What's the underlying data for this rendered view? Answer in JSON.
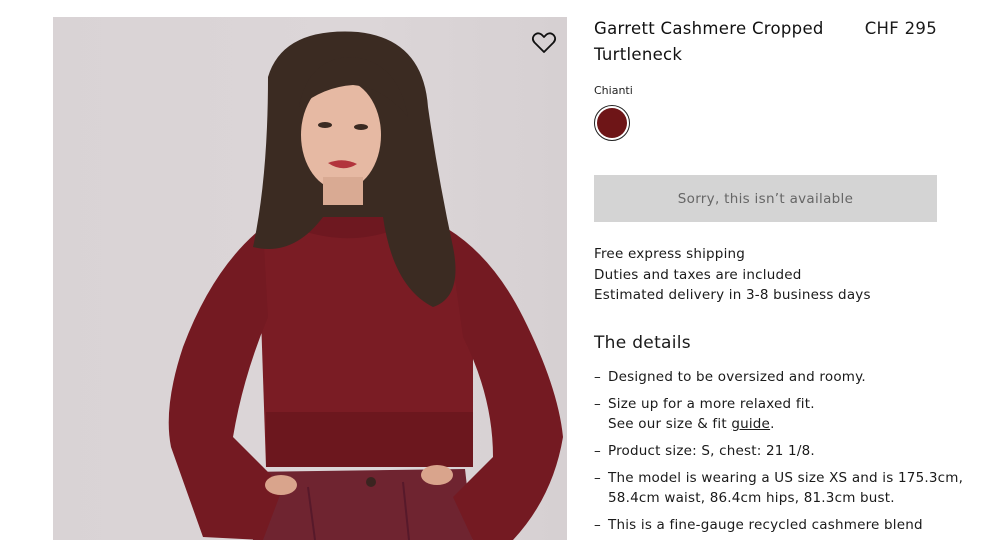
{
  "product": {
    "title": "Garrett Cashmere Cropped Turtleneck",
    "price": "CHF 295",
    "color_name": "Chianti",
    "swatch_color": "#6e1517"
  },
  "actions": {
    "unavailable_label": "Sorry, this isn’t available",
    "wishlist_icon": "heart-outline-icon"
  },
  "shipping": {
    "lines": [
      "Free express shipping",
      "Duties and taxes are included",
      "Estimated delivery in 3-8 business days"
    ]
  },
  "details": {
    "heading": "The details",
    "item1": "Designed to be oversized and roomy.",
    "item2_line1": "Size up for a more relaxed fit.",
    "item2_line2_prefix": "See our size & fit ",
    "item2_link": "guide",
    "item2_suffix": ".",
    "item3": "Product size: S, chest: 21 1/8.",
    "item4_line1": "The model is wearing a US size XS and is 175.3cm,",
    "item4_line2": "58.4cm waist, 86.4cm hips, 81.3cm bust.",
    "item5": "This is a fine-gauge recycled cashmere blend"
  }
}
